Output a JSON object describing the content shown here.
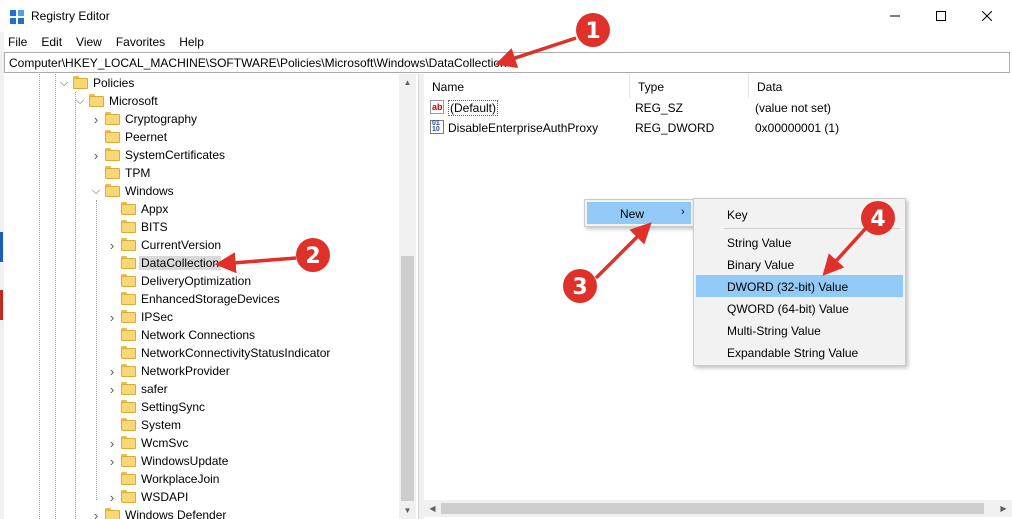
{
  "window": {
    "title": "Registry Editor"
  },
  "menu": [
    "File",
    "Edit",
    "View",
    "Favorites",
    "Help"
  ],
  "address": {
    "path": "Computer\\HKEY_LOCAL_MACHINE\\SOFTWARE\\Policies\\Microsoft\\Windows\\DataCollection"
  },
  "tree": {
    "items": [
      {
        "label": "Policies"
      },
      {
        "label": "Microsoft"
      },
      {
        "label": "Cryptography"
      },
      {
        "label": "Peernet"
      },
      {
        "label": "SystemCertificates"
      },
      {
        "label": "TPM"
      },
      {
        "label": "Windows"
      },
      {
        "label": "Appx"
      },
      {
        "label": "BITS"
      },
      {
        "label": "CurrentVersion"
      },
      {
        "label": "DataCollection"
      },
      {
        "label": "DeliveryOptimization"
      },
      {
        "label": "EnhancedStorageDevices"
      },
      {
        "label": "IPSec"
      },
      {
        "label": "Network Connections"
      },
      {
        "label": "NetworkConnectivityStatusIndicator"
      },
      {
        "label": "NetworkProvider"
      },
      {
        "label": "safer"
      },
      {
        "label": "SettingSync"
      },
      {
        "label": "System"
      },
      {
        "label": "WcmSvc"
      },
      {
        "label": "WindowsUpdate"
      },
      {
        "label": "WorkplaceJoin"
      },
      {
        "label": "WSDAPI"
      },
      {
        "label": "Windows Defender"
      }
    ]
  },
  "list": {
    "columns": [
      "Name",
      "Type",
      "Data"
    ],
    "rows": [
      {
        "icon": "string-value-icon",
        "name": "(Default)",
        "type": "REG_SZ",
        "data": "(value not set)"
      },
      {
        "icon": "binary-value-icon",
        "name": "DisableEnterpriseAuthProxy",
        "type": "REG_DWORD",
        "data": "0x00000001 (1)"
      }
    ]
  },
  "context_menu": {
    "new_label": "New",
    "arrow": "›"
  },
  "submenu": {
    "items": [
      "Key",
      "String Value",
      "Binary Value",
      "DWORD (32-bit) Value",
      "QWORD (64-bit) Value",
      "Multi-String Value",
      "Expandable String Value"
    ],
    "highlighted": "DWORD (32-bit) Value"
  },
  "annotations": {
    "badges": [
      "1",
      "2",
      "3",
      "4"
    ],
    "color": "#e0302a"
  },
  "colors": {
    "highlight": "#91c9f7",
    "selection": "#d9d9d9",
    "folder": "#f8d775"
  }
}
